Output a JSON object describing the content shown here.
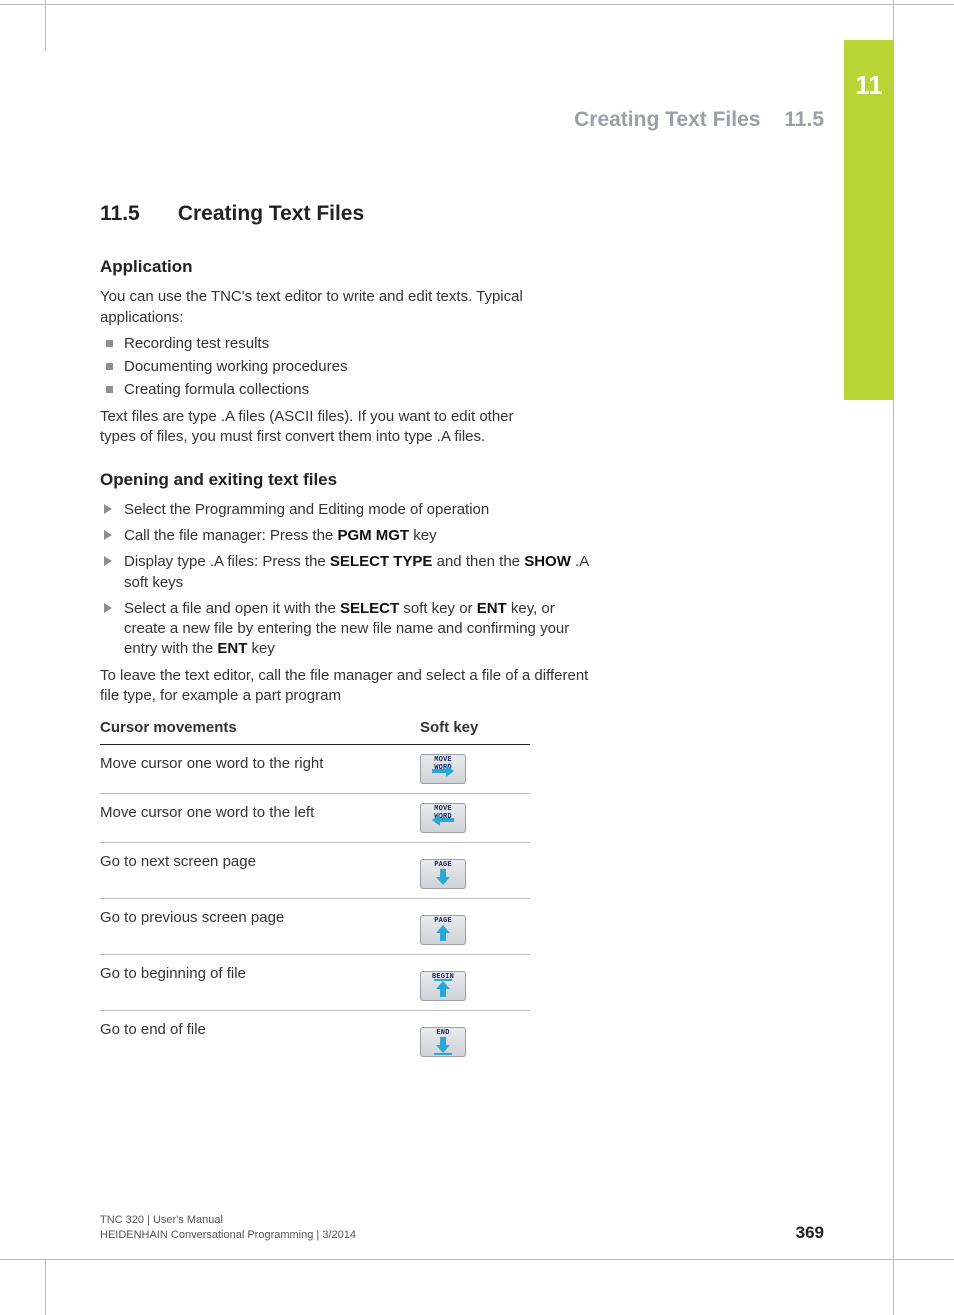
{
  "chapter_number": "11",
  "running_head": {
    "title": "Creating Text Files",
    "number": "11.5"
  },
  "section": {
    "number": "11.5",
    "title": "Creating Text Files"
  },
  "application": {
    "heading": "Application",
    "intro": "You can use the TNC's text editor to write and edit texts. Typical applications:",
    "bullets": [
      "Recording test results",
      "Documenting working procedures",
      "Creating formula collections"
    ],
    "para2": "Text files are type .A files (ASCII files). If you want to edit other types of files, you must first convert them into type .A files."
  },
  "opening": {
    "heading": "Opening and exiting text files",
    "steps": [
      {
        "pre": "Select the Programming and Editing mode of operation"
      },
      {
        "pre": "Call the file manager: Press the ",
        "b1": "PGM MGT",
        "post1": " key"
      },
      {
        "pre": "Display type .A files: Press the ",
        "b1": "SELECT TYPE",
        "mid": " and then the ",
        "b2": "SHOW",
        "post2": " .A soft keys"
      },
      {
        "pre": "Select a file and open it with the ",
        "b1": "SELECT",
        "mid": " soft key or ",
        "b2": "ENT",
        "mid2": " key, or create a new file by entering the new file name and confirming your entry with the ",
        "b3": "ENT",
        "post3": " key"
      }
    ],
    "outro": "To leave the text editor, call the file manager and select a file of a different file type, for example a part program"
  },
  "table": {
    "col1": "Cursor movements",
    "col2": "Soft key",
    "rows": [
      {
        "desc": "Move cursor one word to the right",
        "key": {
          "line1": "MOVE",
          "line2": "WORD",
          "arrow": "right"
        }
      },
      {
        "desc": "Move cursor one word to the left",
        "key": {
          "line1": "MOVE",
          "line2": "WORD",
          "arrow": "left"
        }
      },
      {
        "desc": "Go to next screen page",
        "key": {
          "line1": "PAGE",
          "arrow": "down"
        }
      },
      {
        "desc": "Go to previous screen page",
        "key": {
          "line1": "PAGE",
          "arrow": "up"
        }
      },
      {
        "desc": "Go to beginning of file",
        "key": {
          "line1": "BEGIN",
          "arrow": "up",
          "bar": "top"
        }
      },
      {
        "desc": "Go to end of file",
        "key": {
          "line1": "END",
          "arrow": "down",
          "bar": "bottom"
        }
      }
    ]
  },
  "footer": {
    "line1": "TNC 320 | User's Manual",
    "line2": "HEIDENHAIN Conversational Programming | 3/2014"
  },
  "page_number": "369"
}
